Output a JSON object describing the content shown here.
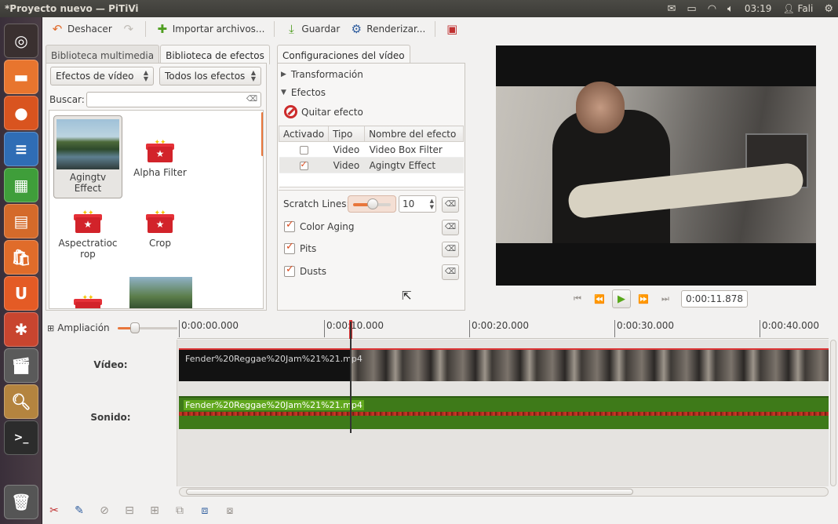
{
  "window": {
    "title": "*Proyecto nuevo — PiTiVi"
  },
  "tray": {
    "battery_icon": "battery-icon",
    "clock": "03:19",
    "user": "Fali"
  },
  "toolbar": {
    "undo_label": "Deshacer",
    "import_label": "Importar archivos...",
    "save_label": "Guardar",
    "render_label": "Renderizar..."
  },
  "left_tabs": [
    "Biblioteca multimedia",
    "Biblioteca de efectos"
  ],
  "effects_filter": {
    "category": "Efectos de vídeo",
    "subcategory": "Todos los efectos",
    "search_label": "Buscar:",
    "search_value": ""
  },
  "effects": [
    {
      "name": "Agingtv Effect",
      "line1": "Agingtv",
      "line2": "Effect"
    },
    {
      "name": "Alpha Filter",
      "line1": "Alpha Filter",
      "line2": ""
    },
    {
      "name": "Aspectratiocrop",
      "line1": "Aspectratioc",
      "line2": "rop"
    },
    {
      "name": "Crop",
      "line1": "Crop",
      "line2": ""
    }
  ],
  "config": {
    "tab": "Configuraciones del vídeo",
    "transform_label": "Transformación",
    "effects_label": "Efectos",
    "remove_effect": "Quitar efecto",
    "columns": [
      "Activado",
      "Tipo",
      "Nombre del efecto"
    ],
    "rows": [
      {
        "enabled": false,
        "type": "Video",
        "name": "Video Box Filter"
      },
      {
        "enabled": true,
        "type": "Video",
        "name": "Agingtv Effect"
      }
    ],
    "props": {
      "scratch_label": "Scratch Lines:",
      "scratch_value": "10",
      "color_aging": "Color Aging",
      "pits": "Pits",
      "dusts": "Dusts"
    }
  },
  "viewer": {
    "time": "0:00:11.878"
  },
  "timeline": {
    "zoom_label": "Ampliación",
    "ticks": [
      "0:00:00.000",
      "0:00:10.000",
      "0:00:20.000",
      "0:00:30.000",
      "0:00:40.000"
    ],
    "video_label": "Vídeo:",
    "audio_label": "Sonido:",
    "clip_name": "Fender%20Reggae%20Jam%21%21.mp4"
  }
}
